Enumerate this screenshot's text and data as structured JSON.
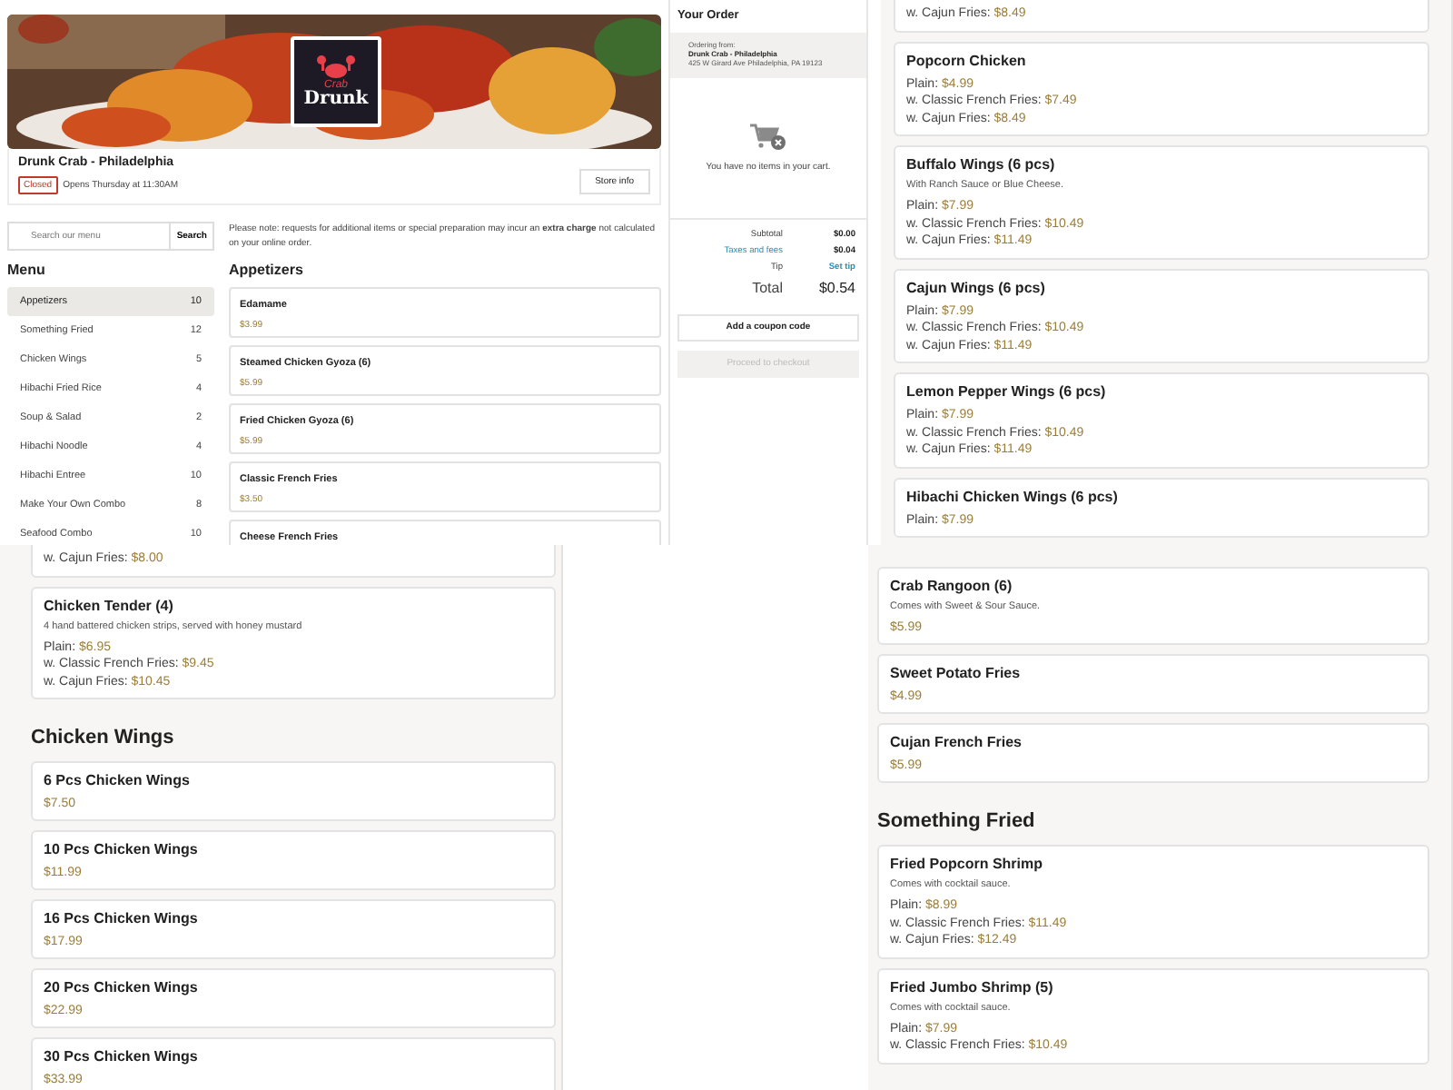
{
  "store": {
    "logo": {
      "top": "Crab",
      "bottom": "Drunk"
    },
    "name": "Drunk Crab - Philadelphia",
    "status": "Closed",
    "hours": "Opens Thursday at 11:30AM",
    "info_button": "Store info"
  },
  "search": {
    "placeholder": "Search our menu",
    "button": "Search"
  },
  "notice": "Please note: requests for additional items or special preparation may incur an **extra charge** not calculated on your online order.",
  "menu": {
    "title": "Menu",
    "categories": [
      {
        "label": "Appetizers",
        "count": "10",
        "selected": true
      },
      {
        "label": "Something Fried",
        "count": "12",
        "selected": false
      },
      {
        "label": "Chicken Wings",
        "count": "5",
        "selected": false
      },
      {
        "label": "Hibachi Fried Rice",
        "count": "4",
        "selected": false
      },
      {
        "label": "Soup & Salad",
        "count": "2",
        "selected": false
      },
      {
        "label": "Hibachi Noodle",
        "count": "4",
        "selected": false
      },
      {
        "label": "Hibachi Entree",
        "count": "10",
        "selected": false
      },
      {
        "label": "Make Your Own Combo",
        "count": "8",
        "selected": false
      },
      {
        "label": "Seafood Combo",
        "count": "10",
        "selected": false
      }
    ]
  },
  "main_section": {
    "title": "Appetizers",
    "items": [
      {
        "name": "Edamame",
        "price": "$3.99"
      },
      {
        "name": "Steamed Chicken Gyoza (6)",
        "price": "$5.99"
      },
      {
        "name": "Fried Chicken Gyoza (6)",
        "price": "$5.99"
      },
      {
        "name": "Classic French Fries",
        "price": "$3.50"
      },
      {
        "name": "Cheese French Fries"
      }
    ]
  },
  "order": {
    "title": "Your Order",
    "from_label": "Ordering from:",
    "from_name": "Drunk Crab - Philadelphia",
    "from_address": "425 W Girard Ave Philadelphia, PA 19123",
    "empty_text": "You have no items in your cart.",
    "totals": [
      {
        "kind": "plain",
        "label": "Subtotal",
        "value": "$0.00"
      },
      {
        "kind": "link",
        "label": "Taxes and fees",
        "value": "$0.04"
      },
      {
        "kind": "action",
        "label": "Tip",
        "value": "Set tip"
      },
      {
        "kind": "total",
        "label": "Total",
        "value": "$0.54"
      }
    ],
    "coupon_button": "Add a coupon code",
    "checkout": {
      "label": "Proceed to checkout",
      "disabled": true
    }
  },
  "panels": [
    {
      "blocks": [
        {
          "kind": "item",
          "options": [
            {
              "label": "w. Cajun Fries: ",
              "price": "$8.49"
            }
          ]
        },
        {
          "kind": "item",
          "name": "Popcorn Chicken",
          "options": [
            {
              "label": "Plain: ",
              "price": "$4.99"
            },
            {
              "label": "w. Classic French Fries: ",
              "price": "$7.49"
            },
            {
              "label": "w. Cajun Fries: ",
              "price": "$8.49"
            }
          ]
        },
        {
          "kind": "item",
          "name": "Buffalo Wings (6 pcs)",
          "description": "With Ranch Sauce or Blue Cheese.",
          "options": [
            {
              "label": "Plain: ",
              "price": "$7.99"
            },
            {
              "label": "w. Classic French Fries: ",
              "price": "$10.49"
            },
            {
              "label": "w. Cajun Fries: ",
              "price": "$11.49"
            }
          ]
        },
        {
          "kind": "item",
          "name": "Cajun Wings (6 pcs)",
          "options": [
            {
              "label": "Plain: ",
              "price": "$7.99"
            },
            {
              "label": "w. Classic French Fries: ",
              "price": "$10.49"
            },
            {
              "label": "w. Cajun Fries: ",
              "price": "$11.49"
            }
          ]
        },
        {
          "kind": "item",
          "name": "Lemon Pepper Wings (6 pcs)",
          "options": [
            {
              "label": "Plain: ",
              "price": "$7.99"
            },
            {
              "label": "w. Classic French Fries: ",
              "price": "$10.49"
            },
            {
              "label": "w. Cajun Fries: ",
              "price": "$11.49"
            }
          ]
        },
        {
          "kind": "item",
          "name": "Hibachi Chicken Wings (6 pcs)",
          "options": [
            {
              "label": "Plain: ",
              "price": "$7.99"
            }
          ]
        }
      ]
    },
    {
      "blocks": [
        {
          "kind": "item",
          "options": [
            {
              "label": "w. Cajun Fries: ",
              "price": "$8.00"
            }
          ]
        },
        {
          "kind": "item",
          "name": "Chicken Tender (4)",
          "description": "4 hand battered chicken strips, served with honey mustard",
          "options": [
            {
              "label": "Plain: ",
              "price": "$6.95"
            },
            {
              "label": "w. Classic French Fries: ",
              "price": "$9.45"
            },
            {
              "label": "w. Cajun Fries: ",
              "price": "$10.45"
            }
          ]
        },
        {
          "kind": "heading",
          "title": "Chicken Wings"
        },
        {
          "kind": "item",
          "name": "6 Pcs Chicken Wings",
          "price": "$7.50"
        },
        {
          "kind": "item",
          "name": "10 Pcs Chicken Wings",
          "price": "$11.99"
        },
        {
          "kind": "item",
          "name": "16 Pcs Chicken Wings",
          "price": "$17.99"
        },
        {
          "kind": "item",
          "name": "20 Pcs Chicken Wings",
          "price": "$22.99"
        },
        {
          "kind": "item",
          "name": "30 Pcs Chicken Wings",
          "price": "$33.99"
        }
      ]
    },
    {
      "blocks": [
        {
          "kind": "item",
          "name": "Crab Rangoon (6)",
          "description": "Comes with Sweet & Sour Sauce.",
          "price": "$5.99"
        },
        {
          "kind": "item",
          "name": "Sweet Potato Fries",
          "price": "$4.99"
        },
        {
          "kind": "item",
          "name": "Cujan French Fries",
          "price": "$5.99"
        },
        {
          "kind": "heading",
          "title": "Something Fried"
        },
        {
          "kind": "item",
          "name": "Fried Popcorn Shrimp",
          "description": "Comes with cocktail sauce.",
          "options": [
            {
              "label": "Plain: ",
              "price": "$8.99"
            },
            {
              "label": "w. Classic French Fries: ",
              "price": "$11.49"
            },
            {
              "label": "w. Cajun Fries: ",
              "price": "$12.49"
            }
          ]
        },
        {
          "kind": "item",
          "name": "Fried Jumbo Shrimp (5)",
          "description": "Comes with cocktail sauce.",
          "options": [
            {
              "label": "Plain: ",
              "price": "$7.99"
            },
            {
              "label": "w. Classic French Fries: ",
              "price": "$10.49"
            }
          ]
        }
      ]
    }
  ]
}
